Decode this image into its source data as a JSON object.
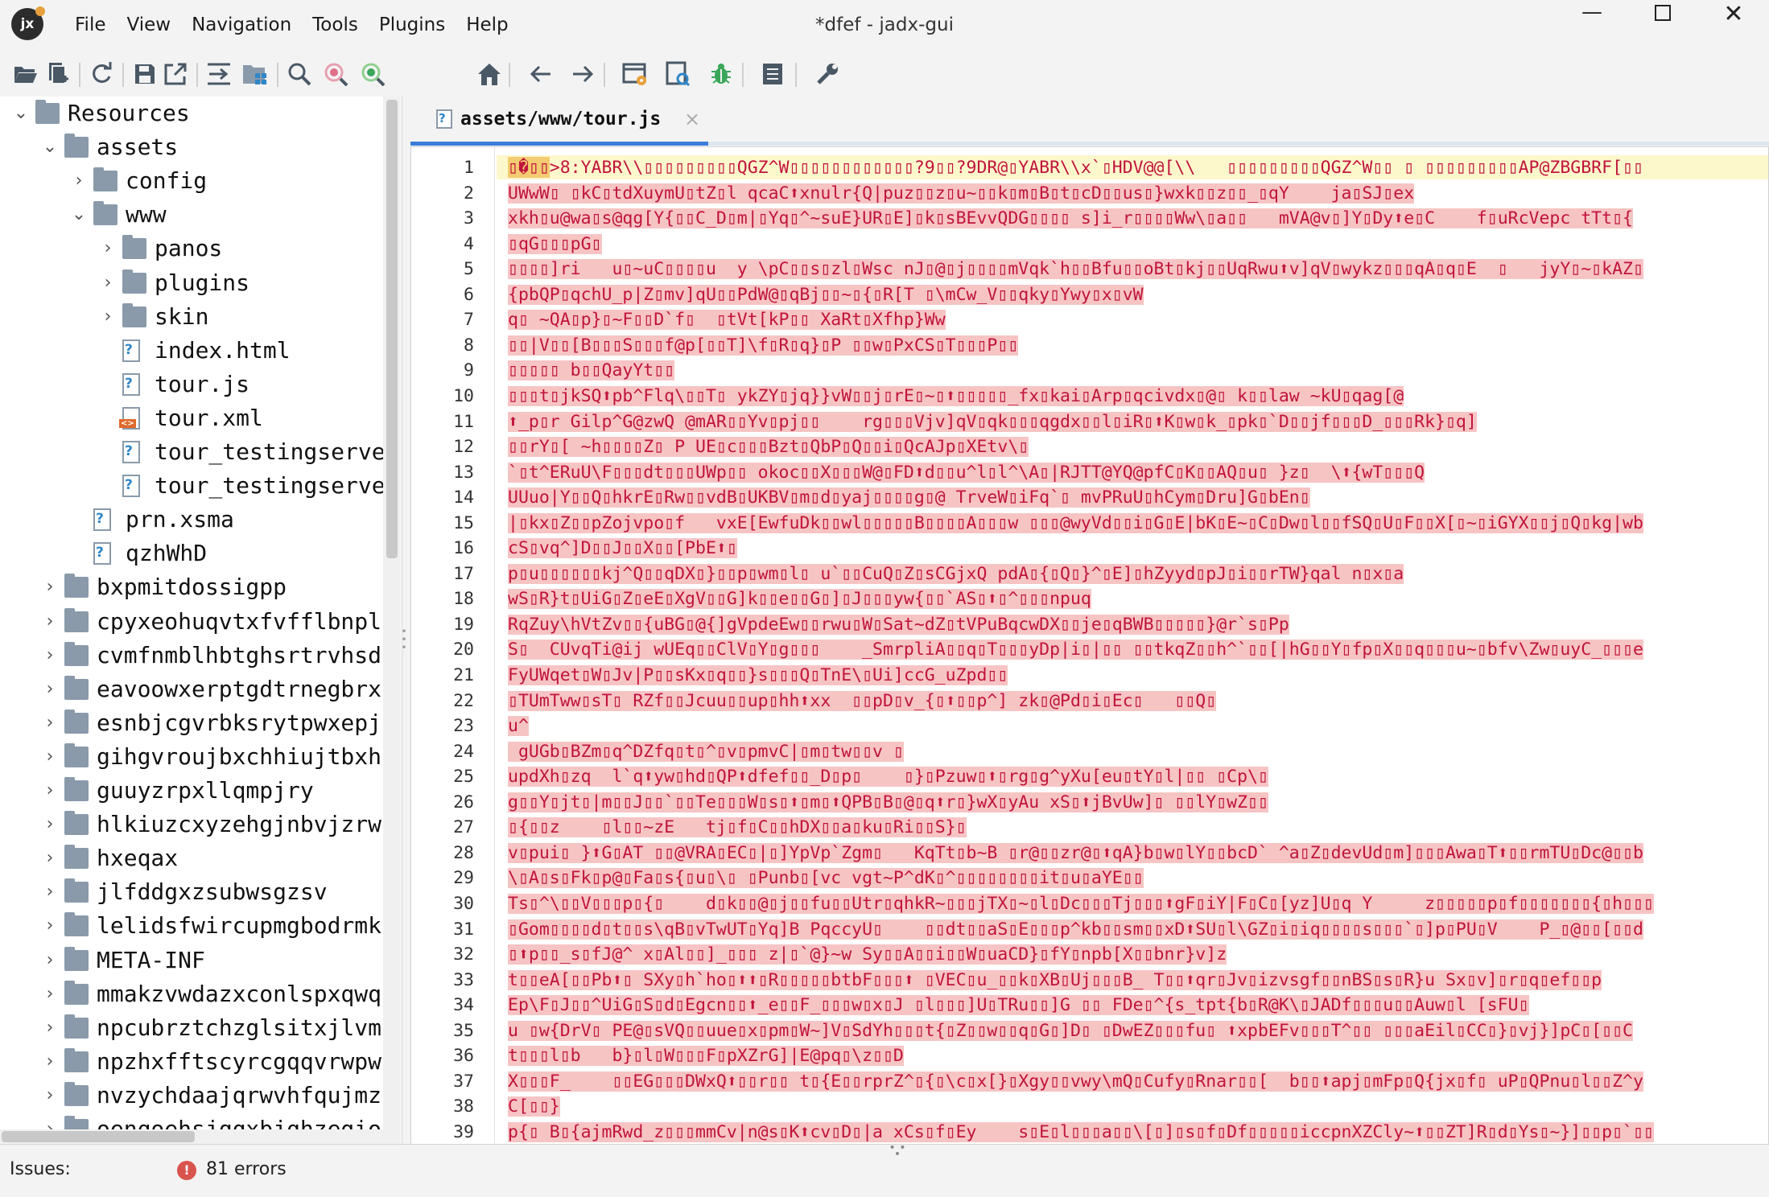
{
  "window": {
    "title": "*dfef - jadx-gui",
    "logo_text": "jx",
    "minimize_glyph": "—",
    "close_glyph": "✕"
  },
  "menu": [
    "File",
    "View",
    "Navigation",
    "Tools",
    "Plugins",
    "Help"
  ],
  "toolbar_icons": [
    "open-folder-icon",
    "add-files-icon",
    "refresh-icon",
    "save-icon",
    "export-icon",
    "sync-with-editor-icon",
    "flatten-packages-icon",
    "search-icon",
    "find-class-icon",
    "find-usage-icon",
    "home-icon",
    "back-arrow-icon",
    "forward-arrow-icon",
    "deobfuscation-icon",
    "quark-icon",
    "debugger-icon",
    "log-viewer-icon",
    "preferences-icon"
  ],
  "tree": {
    "items": [
      {
        "label": "Resources",
        "level": 0,
        "type": "resources",
        "expanded": true
      },
      {
        "label": "assets",
        "level": 1,
        "type": "folder",
        "expanded": true
      },
      {
        "label": "config",
        "level": 2,
        "type": "folder",
        "expanded": false
      },
      {
        "label": "www",
        "level": 2,
        "type": "folder",
        "expanded": true
      },
      {
        "label": "panos",
        "level": 3,
        "type": "folder",
        "expanded": false
      },
      {
        "label": "plugins",
        "level": 3,
        "type": "folder",
        "expanded": false
      },
      {
        "label": "skin",
        "level": 3,
        "type": "folder",
        "expanded": false
      },
      {
        "label": "index.html",
        "level": 3,
        "type": "file"
      },
      {
        "label": "tour.js",
        "level": 3,
        "type": "file"
      },
      {
        "label": "tour.xml",
        "level": 3,
        "type": "xml"
      },
      {
        "label": "tour_testingserve",
        "level": 3,
        "type": "file"
      },
      {
        "label": "tour_testingserve",
        "level": 3,
        "type": "file"
      },
      {
        "label": "prn.xsma",
        "level": 2,
        "type": "file"
      },
      {
        "label": "qzhWhD",
        "level": 2,
        "type": "file"
      },
      {
        "label": "bxpmitdossigpp",
        "level": 1,
        "type": "folder",
        "expanded": false
      },
      {
        "label": "cpyxeohuqvtxfvfflbnpl",
        "level": 1,
        "type": "folder",
        "expanded": false
      },
      {
        "label": "cvmfnmblhbtghsrtrvhsd",
        "level": 1,
        "type": "folder",
        "expanded": false
      },
      {
        "label": "eavoowxerptgdtrnegbrx",
        "level": 1,
        "type": "folder",
        "expanded": false
      },
      {
        "label": "esnbjcgvrbksrytpwxepj",
        "level": 1,
        "type": "folder",
        "expanded": false
      },
      {
        "label": "gihgvroujbxchhiujtbxh",
        "level": 1,
        "type": "folder",
        "expanded": false
      },
      {
        "label": "guuyzrpxllqmpjry",
        "level": 1,
        "type": "folder",
        "expanded": false
      },
      {
        "label": "hlkiuzcxyzehgjnbvjzrw",
        "level": 1,
        "type": "folder",
        "expanded": false
      },
      {
        "label": "hxeqax",
        "level": 1,
        "type": "folder",
        "expanded": false
      },
      {
        "label": "jlfddgxzsubwsgzsv",
        "level": 1,
        "type": "folder",
        "expanded": false
      },
      {
        "label": "lelidsfwircupmgbodrmk",
        "level": 1,
        "type": "folder",
        "expanded": false
      },
      {
        "label": "META-INF",
        "level": 1,
        "type": "folder",
        "expanded": false
      },
      {
        "label": "mmakzvwdazxconlspxqwq",
        "level": 1,
        "type": "folder",
        "expanded": false
      },
      {
        "label": "npcubrztchzglsitxjlvm",
        "level": 1,
        "type": "folder",
        "expanded": false
      },
      {
        "label": "npzhxfftscyrcgqqvrwpws",
        "level": 1,
        "type": "folder",
        "expanded": false
      },
      {
        "label": "nvzychdaajqrwvhfqujmz",
        "level": 1,
        "type": "folder",
        "expanded": false
      },
      {
        "label": "oenqoehsjqqxbjqhzegio",
        "level": 1,
        "type": "folder",
        "expanded": false
      }
    ]
  },
  "editor": {
    "tab_title": "assets/www/tour.js",
    "tab_close": "×",
    "lines": [
      "▯�▯▯>8:YABR\\\\▯▯▯▯▯▯▯▯▯QGZ^W▯▯▯▯▯▯▯▯▯▯▯▯?9▯▯?9DR@▯YABR\\\\x`▯HDV@@[\\\\   ▯▯▯▯▯▯▯▯▯QGZ^W▯▯ ▯ ▯▯▯▯▯▯▯▯▯AP@ZBGBRF[▯▯",
      "UWwW▯ ▯kC▯tdXuymU▯tZ▯l qcaC⬆xnulr{Q|puz▯▯z▯u~▯▯k▯m▯B▯t▯cD▯▯us▯}wxk▯▯z▯▯_▯qY    ja▯SJ▯ex",
      "xkh▯u@wa▯s@qg[Y{▯▯C_D▯m|▯Yq▯^~suE}UR▯E]▯k▯sBEvvQDG▯▯▯▯ s]i_r▯▯▯▯Ww\\▯a▯▯   mVA@v▯]Y▯Dy⬆e▯C    f▯uRcVepc tTt▯{",
      "▯qG▯▯▯pG▯",
      "▯▯▯▯]ri   u▯~uC▯▯▯▯u  y \\pC▯▯s▯zl▯Wsc nJ▯@▯j▯▯▯▯mVqk`h▯▯Bfu▯▯oBt▯kj▯▯UqRwu⬆v]qV▯wykz▯▯▯qA▯q▯E  ▯   jyY▯~▯kAZ▯",
      "{pbQP▯qchU_p|Z▯mv]qU▯▯PdW@▯qBj▯▯~▯{▯R[T ▯\\mCw_V▯▯qky▯Ywy▯x▯vW",
      "q▯ ~QA▯p}▯~F▯▯D`f▯  ▯tVt[kP▯▯ XaRt▯Xfhp}Ww",
      "▯▯|V▯▯[B▯▯▯S▯▯▯f@p[▯▯T]\\f▯R▯q}▯P ▯▯w▯PxCS▯T▯▯▯P▯▯",
      "▯▯▯▯▯ b▯▯QayYt▯▯",
      "▯▯▯t▯jkSQ⬆pb^Flq\\▯▯T▯ ykZY▯jq}}vW▯▯j▯rE▯~▯⬆▯▯▯▯▯_fx▯kai▯Arp▯qcivdx▯@▯ k▯▯law ~kU▯qag[@",
      "⬆_p▯r Gilp^G@zwQ @mAR▯▯Yv▯pj▯▯    rg▯▯▯Vjv]qV▯qk▯▯▯qgdx▯▯l▯iR▯⬆K▯w▯k_▯pk▯`D▯▯jf▯▯▯D_▯▯▯Rk}▯q]",
      "▯▯rY▯[ ~h▯▯▯▯Z▯ P UE▯c▯▯▯Bzt▯QbP▯Q▯▯i▯QcAJp▯XEtv\\▯",
      "`▯t^ERuU\\F▯▯▯dt▯▯▯UWp▯▯ okoc▯▯X▯▯▯W@▯FD⬆d▯▯u^l▯l^\\A▯|RJTT@YQ@pfC▯K▯▯AQ▯u▯ }z▯  \\⬆{wT▯▯▯Q",
      "UUuo|Y▯▯Q▯hkrE▯Rw▯▯vdB▯UKBV▯m▯d▯yaj▯▯▯▯g▯@ TrveW▯iFq`▯ mvPRuU▯hCym▯Dru]G▯bEn▯",
      "|▯kx▯Z▯▯pZojvpo▯f   vxE[EwfuDk▯▯wl▯▯▯▯▯B▯▯▯▯A▯▯▯w ▯▯▯@wyVd▯▯i▯G▯E|bK▯E~▯C▯Dw▯l▯▯fSQ▯U▯F▯▯X[▯~▯iGYX▯▯j▯Q▯kg|wb",
      "cS▯vq^]D▯▯J▯▯X▯▯[PbE⬆▯",
      "p▯u▯▯▯▯▯▯kj^Q▯▯qDX▯}▯▯p▯wm▯l▯ u`▯▯CuQ▯Z▯sCGjxQ pdA▯{▯Q▯}^▯E]▯hZyyd▯pJ▯i▯▯rTW}qal n▯x▯a",
      "wS▯R}t▯UiG▯Z▯eE▯XgV▯▯G]k▯▯e▯▯G▯]▯J▯▯▯yw{▯▯`AS▯⬆▯^▯▯▯npuq",
      "RqZuy\\hVtZv▯▯{uBG▯@{]gVpdeEw▯▯rwu▯W▯Sat~dZ▯tVPuBqcwDX▯▯je▯qBWB▯▯▯▯▯}@r`s▯Pp",
      "S▯  CUvqTi@ij wUEq▯▯ClV▯Y▯g▯▯▯    _SmrpliA▯▯q▯T▯▯▯yDp|i▯|▯▯ ▯▯tkqZ▯▯h^`▯▯[|hG▯▯Y▯fp▯X▯▯q▯▯▯u~▯bfv\\Zw▯uyC_▯▯▯e",
      "FyUWqet▯W▯Jv|P▯▯sKx▯q▯▯}s▯▯▯Q▯TnE\\▯Ui]ccG_uZpd▯▯",
      "▯TUmTww▯sT▯ RZf▯▯Jcuu▯▯up▯hh⬆xx  ▯▯pD▯v_{▯⬆▯▯p^] zk▯@Pd▯i▯Ec▯   ▯▯Q▯",
      "u^",
      " gUGb▯BZm▯q^DZfq▯t▯^▯v▯pmvC|▯m▯tw▯▯v ▯",
      "updXh▯zq  l`q⬆yw▯hd▯QP⬆dfef▯▯_D▯p▯    ▯}▯Pzuw▯⬆▯rg▯g^yXu[eu▯tY▯l|▯▯ ▯Cp\\▯",
      "g▯▯Y▯jt▯|m▯▯J▯▯`▯▯Te▯▯▯W▯s▯⬆▯m▯⬆QPB▯B▯@▯q⬆r▯}wX▯yAu xS▯⬆jBvUw]▯ ▯▯lY▯wZ▯▯",
      "▯{▯▯z    ▯l▯▯~zE   tj▯f▯C▯▯hDX▯▯a▯ku▯Ri▯▯S}▯",
      "v▯pui▯ }⬆G▯AT ▯▯@VRA▯EC▯|▯]YpVp`Zgm▯   KqTt▯b~B ▯r@▯▯zr@▯⬆qA}b▯w▯lY▯▯bcD` ^a▯Z▯devUd▯m]▯▯▯Awa▯T⬆▯▯rmTU▯Dc@▯▯b",
      "\\▯A▯s▯Fk▯p@▯Fa▯s{▯u▯\\▯ ▯Punb▯[vc vgt~P^dK▯^▯▯▯▯▯▯▯▯it▯u▯aYE▯▯",
      "Ts▯^\\▯▯V▯▯▯p▯{▯    d▯k▯▯@▯j▯▯fu▯▯Utr▯qhkR~▯▯▯jTX▯~▯l▯Dc▯▯▯Tj▯▯▯⬆gF▯iY|F▯C▯[yz]U▯q Y     z▯▯▯▯▯p▯f▯▯▯▯▯▯▯{▯h▯▯▯",
      "▯Gom▯▯▯▯d▯t▯▯s\\qB▯vTwUT▯Yq]B PqccyU▯    ▯▯dt▯▯aS▯E▯▯▯p^kb▯▯sm▯▯xD⬆SU▯l\\GZ▯i▯iq▯▯▯▯s▯▯▯`▯]p▯PU▯V    P_▯@▯▯[▯▯d",
      "▯⬆p▯▯_s▯fJ@^ x▯Al▯▯]_▯▯▯ z|▯`@}~w Sy▯▯A▯▯i▯▯W▯uaCD}▯fY▯npb[X▯▯bnr}v]z",
      "t▯▯eA[▯▯Pb⬆▯ SXy▯h`ho▯⬆⬆▯R▯▯▯▯▯btbF▯▯▯⬆ ▯VEC▯u_▯▯k▯XB▯Uj▯▯▯B_ T▯▯⬆qr▯Jv▯izvsgf▯▯nBS▯s▯R}u Sx▯v]▯r▯q▯ef▯▯p",
      "Ep\\F▯J▯▯^UiG▯S▯d▯Egcn▯▯⬆_e▯▯F_▯▯▯w▯x▯J ▯l▯▯▯]U▯TRu▯▯]G ▯▯ FDe▯^{s_tpt{b▯R@K\\▯JADf▯▯▯u▯▯Auw▯l [sFU▯",
      "u ▯w{DrV▯ PE@▯sVQ▯▯uue▯x▯pm▯W~]V▯SdYh▯▯▯t{▯Z▯▯w▯▯q▯G▯]D▯ ▯DwEZ▯▯▯fu▯ ⬆xpbEFv▯▯▯T^▯▯ ▯▯▯aEil▯CC▯}▯vj}]pC▯[▯▯C",
      "t▯▯▯l▯b   b}▯l▯W▯▯▯F▯pXZrG]|E@pq▯\\z▯▯D",
      "X▯▯▯F_    ▯▯EG▯▯▯DWxQ⬆▯▯r▯▯ t▯{E▯▯rprZ^▯{▯\\c▯x[}▯Xgy▯▯vwy\\mQ▯Cufy▯Rnar▯▯[  b▯▯⬆apj▯mFp▯Q{jx▯f▯ uP▯QPnu▯l▯▯Z^y",
      "C[▯▯}",
      "p{▯ B▯{ajmRwd_z▯▯▯mmCv|n@s▯K⬆cv▯D▯|a xCs▯f▯Ey    s▯E▯l▯▯▯a▯▯\\[▯]▯s▯f▯Df▯▯▯▯▯iccpnXZCly~⬆▯▯ZT]R▯d▯Ys▯~}]▯▯p▯`▯▯"
    ]
  },
  "status": {
    "issues_label": "Issues:",
    "error_glyph": "!",
    "error_count": "81 errors"
  },
  "colors": {
    "code_text": "#c0143c",
    "code_highlight": "#f7c4c4",
    "accent": "#3b7dd8",
    "error": "#d9534f"
  }
}
